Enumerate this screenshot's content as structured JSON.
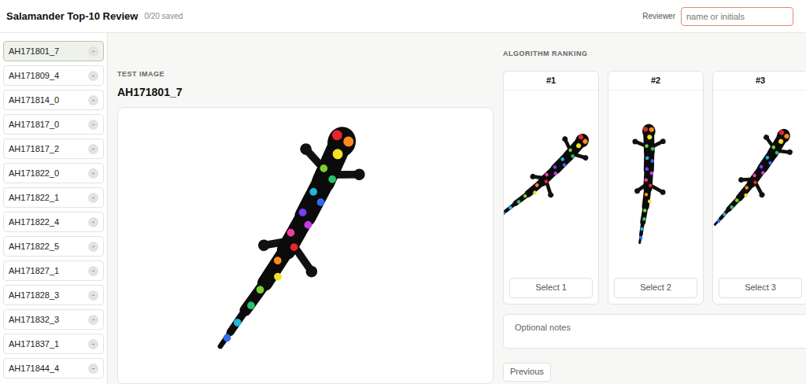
{
  "header": {
    "title": "Salamander Top-10 Review",
    "saved": "0/20 saved",
    "reviewer_label": "Reviewer",
    "reviewer_placeholder": "name or initials",
    "reviewer_highlighted": true
  },
  "sidebar": {
    "items": [
      {
        "label": "AH171801_7",
        "badge": "-",
        "selected": true
      },
      {
        "label": "AH171809_4",
        "badge": "-",
        "selected": false
      },
      {
        "label": "AH171814_0",
        "badge": "-",
        "selected": false
      },
      {
        "label": "AH171817_0",
        "badge": "-",
        "selected": false
      },
      {
        "label": "AH171817_2",
        "badge": "-",
        "selected": false
      },
      {
        "label": "AH171822_0",
        "badge": "-",
        "selected": false
      },
      {
        "label": "AH171822_1",
        "badge": "-",
        "selected": false
      },
      {
        "label": "AH171822_4",
        "badge": "-",
        "selected": false
      },
      {
        "label": "AH171822_5",
        "badge": "-",
        "selected": false
      },
      {
        "label": "AH171827_1",
        "badge": "-",
        "selected": false
      },
      {
        "label": "AH171828_3",
        "badge": "-",
        "selected": false
      },
      {
        "label": "AH171832_3",
        "badge": "-",
        "selected": false
      },
      {
        "label": "AH171837_1",
        "badge": "-",
        "selected": false
      },
      {
        "label": "AH171844_4",
        "badge": "-",
        "selected": false
      }
    ]
  },
  "test": {
    "heading": "TEST IMAGE",
    "id": "AH171801_7"
  },
  "ranking": {
    "heading": "ALGORITHM RANKING",
    "candidates": [
      {
        "rank": "#1",
        "button": "Select 1"
      },
      {
        "rank": "#2",
        "button": "Select 2"
      },
      {
        "rank": "#3",
        "button": "Select 3"
      }
    ]
  },
  "notes": {
    "placeholder": "Optional notes"
  },
  "buttons": {
    "previous": "Previous"
  }
}
